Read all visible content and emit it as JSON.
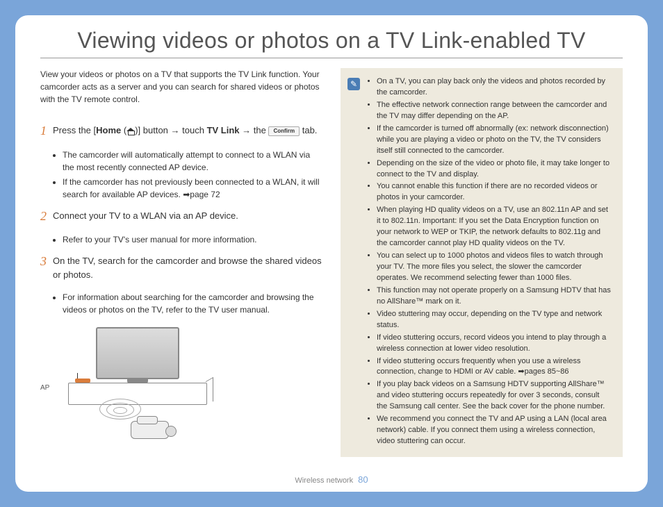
{
  "title": "Viewing videos or photos on a TV Link-enabled TV",
  "intro": "View your videos or photos on a TV that supports the TV Link function. Your camcorder acts as a server and you can search for shared videos or photos with the TV remote control.",
  "steps": [
    {
      "num": "1",
      "pre": "Press the [",
      "bold1": "Home",
      "mid1": " (",
      "mid2": ")] button → touch ",
      "bold2": "TV Link",
      "mid3": " → the ",
      "confirm": "Confirm",
      "end": " tab.",
      "bullets": [
        "The camcorder will automatically attempt to connect to a WLAN via the most recently connected AP device.",
        "If the camcorder has not previously been connected to a WLAN, it will search for available AP devices. ➡page 72"
      ]
    },
    {
      "num": "2",
      "text": "Connect your TV to a WLAN via an AP device.",
      "bullets": [
        "Refer to your TV's user manual for more information."
      ]
    },
    {
      "num": "3",
      "text": "On the TV, search for the camcorder and browse the shared videos or photos.",
      "bullets": [
        "For information about searching for the camcorder and browsing the videos or photos on the TV, refer to the TV user manual."
      ]
    }
  ],
  "ap_label": "AP",
  "info": [
    "On a TV, you can play back only the videos and photos recorded by the camcorder.",
    "The effective network connection range between the camcorder and the TV may differ depending on the AP.",
    "If the camcorder is turned off abnormally (ex: network disconnection) while you are playing a video or photo on the TV, the TV considers itself still connected to the camcorder.",
    "Depending on the size of the video or photo file, it may take longer to connect to the TV and display.",
    "You cannot enable this function if there are no recorded videos or photos in your camcorder.",
    "When playing HD quality videos on a TV, use an 802.11n AP and set it to 802.11n. Important: If you set the Data Encryption function on your network to WEP or TKIP, the network defaults to 802.11g and the camcorder cannot play HD quality videos on the TV.",
    "You can select up to 1000 photos and videos files to watch through your TV. The more files you select, the slower the camcorder operates. We recommend selecting fewer than 1000 files.",
    "This function may not operate properly on a Samsung HDTV that has no AllShare™ mark on it.",
    "Video stuttering may occur, depending on the TV type and network status.",
    "If video stuttering occurs, record videos you intend to play through a wireless connection at lower video resolution.",
    "If video stuttering occurs frequently when you use a wireless connection, change to HDMI or AV cable. ➡pages 85~86",
    "If you play back videos on a Samsung HDTV supporting AllShare™ and video stuttering occurs repeatedly for over 3 seconds, consult the Samsung call center. See the back cover for the phone number.",
    "We recommend you connect the TV and AP using a LAN (local area network) cable. If you connect them using a wireless connection, video stuttering can occur."
  ],
  "footer_section": "Wireless network",
  "footer_page": "80"
}
